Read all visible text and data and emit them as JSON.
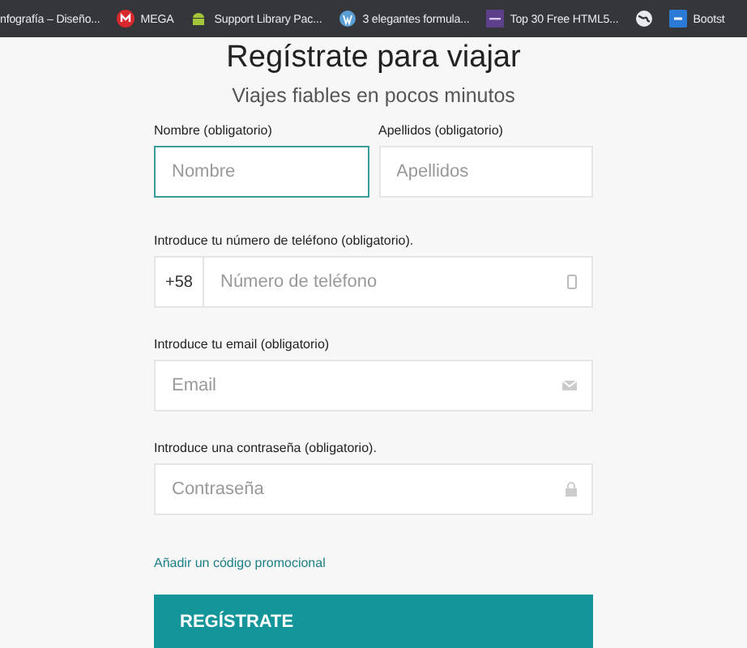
{
  "bookmarks": [
    {
      "label": "nfografía – Diseño...",
      "kind": "none"
    },
    {
      "label": "MEGA",
      "kind": "mega"
    },
    {
      "label": "Support Library Pac...",
      "kind": "android"
    },
    {
      "label": "3 elegantes formula...",
      "kind": "wordpress"
    },
    {
      "label": "Top 30 Free HTML5...",
      "kind": "bars"
    },
    {
      "kind": "globe"
    },
    {
      "label": "Bootst",
      "kind": "bootstrap"
    }
  ],
  "form": {
    "title": "Regístrate para viajar",
    "subtitle": "Viajes fiables en pocos minutos",
    "name_fields": [
      {
        "label": "Nombre (obligatorio)",
        "placeholder": "Nombre",
        "focused": true
      },
      {
        "label": "Apellidos (obligatorio)",
        "placeholder": "Apellidos",
        "focused": false
      }
    ],
    "phone": {
      "label": "Introduce tu número de teléfono (obligatorio).",
      "prefix": "+58",
      "placeholder": "Número de teléfono"
    },
    "email": {
      "label": "Introduce tu email (obligatorio)",
      "placeholder": "Email"
    },
    "password": {
      "label": "Introduce una contraseña (obligatorio).",
      "placeholder": "Contraseña"
    },
    "promo_link": "Añadir un código promocional",
    "submit": "REGÍSTRATE"
  }
}
